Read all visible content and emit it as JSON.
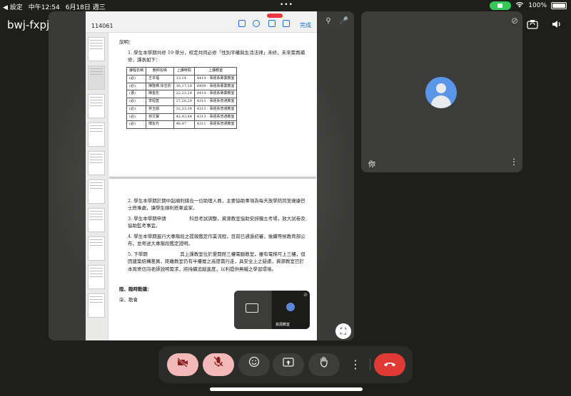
{
  "status_bar": {
    "back_label": "◀ 設定",
    "time": "中午12:54",
    "date": "6月18日 週三",
    "battery": "100%",
    "battery_level": 1.0
  },
  "meeting": {
    "code": "bwj-fxpj-uiz",
    "chevron": "▸"
  },
  "document": {
    "page_number": "114061",
    "done_label": "完成",
    "page1": {
      "heading": "說明：",
      "item1": "1. 學生本學期共修 19 學分，校定共同必修「性別平權與生活法律」未修，未來需再補修，課表如下：",
      "table_headers": [
        "課程名稱",
        "教師名稱",
        "上課時間",
        "上課教室"
      ],
      "table_rows": [
        [
          "(必)",
          "王本福",
          "13,14",
          "4414 - 事經系專業教室"
        ],
        [
          "(必)",
          "陳隆輝,徐志豹",
          "16,17,18",
          "6409 - 事經系專業教室"
        ],
        [
          "(選)",
          "陳金宏",
          "22,23,24",
          "4414 - 事經系專業教室"
        ],
        [
          "(必)",
          "李姮萱",
          "27,28,29",
          "4313 - 事經系普通教室"
        ],
        [
          "(必)",
          "林玉娟",
          "32,33,34",
          "4313 - 事經系普通教室"
        ],
        [
          "(必)",
          "林文寶",
          "42,43,44",
          "4313 - 事經系普通教室"
        ],
        [
          "(必)",
          "傅友光",
          "46,47",
          "4311 - 事經系普通教室"
        ]
      ]
    },
    "page2": {
      "item2": "2. 學生本學期於期中起順利媒合一位助理人員，主要協助事項為每天放學陪同至復康巴士搭乘處，讓學生順利搭車返家。",
      "item3": "3. 學生本學期申請　　　　　科目考試調整，資源教室協助安排獨立考場，放大試卷及協助監考事宜。",
      "item4": "4. 學生本學期進行大專階段之提報鑑定作業流程，目前已通過初審，後續等候教育部公布，並寄送大專階段鑑定證明。",
      "item5": "5. 下學期　　　　　　　其上課教室位於愛閱館三樓電腦教室，雖有電梯可上三樓，但因建築結構差異，距離教室仍有半樓層之高度需行走，具安全上之疑慮，資源教室已於本周寄信向老師說明需求，將持續追蹤進度，以利提供無礙之學習環境。",
      "section": "陸、臨時動議：",
      "section_item": "柒、散會"
    }
  },
  "pip": {
    "caption": "資源教室"
  },
  "self_tile": {
    "name": "你",
    "more": "⋮"
  },
  "controls": {
    "camera_icon": "camera-off-icon",
    "mic_icon": "mic-off-icon",
    "emoji_icon": "emoji-icon",
    "present_icon": "present-icon",
    "hand_icon": "raise-hand-icon",
    "more": "⋮",
    "end_icon": "end-call-icon"
  },
  "colors": {
    "background": "#1e1f1a",
    "pink_button": "#f3b8b8",
    "end_call": "#e13a34",
    "avatar": "#5a96e8",
    "battery_green": "#34c759"
  }
}
